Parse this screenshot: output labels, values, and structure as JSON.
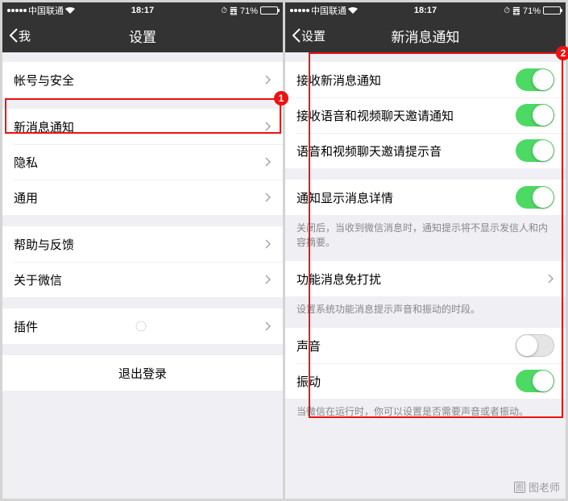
{
  "status": {
    "carrier": "中国联通",
    "time": "18:17",
    "battery": "71%"
  },
  "left": {
    "back_label": "我",
    "title": "设置",
    "group1": [
      {
        "label": "帐号与安全"
      }
    ],
    "group2": [
      {
        "label": "新消息通知"
      },
      {
        "label": "隐私"
      },
      {
        "label": "通用"
      }
    ],
    "group3": [
      {
        "label": "帮助与反馈"
      },
      {
        "label": "关于微信"
      }
    ],
    "group4": [
      {
        "label": "插件"
      }
    ],
    "logout": "退出登录"
  },
  "right": {
    "back_label": "设置",
    "title": "新消息通知",
    "group1": [
      {
        "label": "接收新消息通知",
        "toggle": true
      },
      {
        "label": "接收语音和视频聊天邀请通知",
        "toggle": true
      },
      {
        "label": "语音和视频聊天邀请提示音",
        "toggle": true
      }
    ],
    "group2": [
      {
        "label": "通知显示消息详情",
        "toggle": true
      }
    ],
    "footer2": "关闭后，当收到微信消息时，通知提示将不显示发信人和内容摘要。",
    "group3": [
      {
        "label": "功能消息免打扰"
      }
    ],
    "footer3": "设置系统功能消息提示声音和振动的时段。",
    "group4": [
      {
        "label": "声音",
        "toggle": false
      },
      {
        "label": "振动",
        "toggle": true
      }
    ],
    "footer4": "当微信在运行时，你可以设置是否需要声音或者振动。"
  },
  "badges": {
    "b1": "1",
    "b2": "2"
  },
  "watermark": "图老师"
}
